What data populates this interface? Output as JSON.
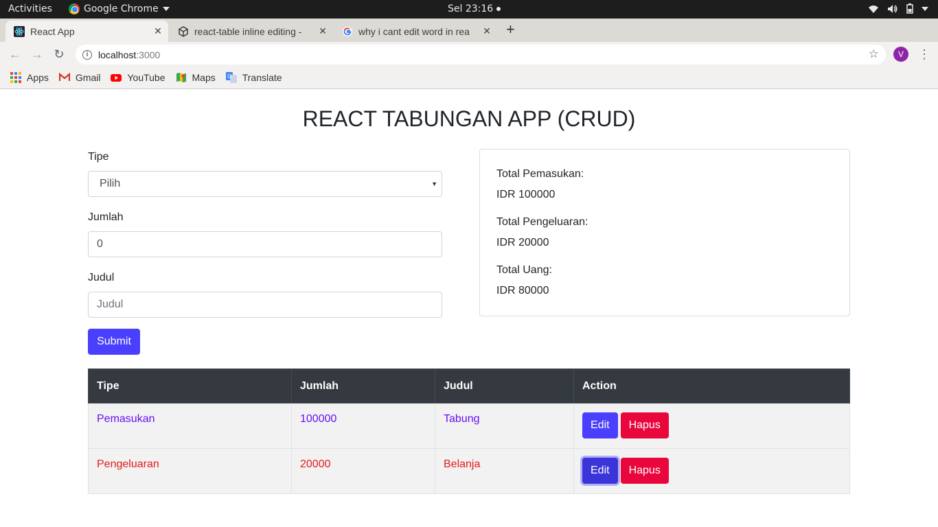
{
  "system_bar": {
    "activities": "Activities",
    "app_name": "Google Chrome",
    "clock": "Sel 23:16"
  },
  "browser": {
    "tabs": [
      {
        "title": "React App",
        "active": true
      },
      {
        "title": "react-table inline editing -",
        "active": false
      },
      {
        "title": "why i cant edit word in rea",
        "active": false
      }
    ],
    "url_host": "localhost",
    "url_port": ":3000",
    "avatar_letter": "V",
    "bookmarks": [
      "Apps",
      "Gmail",
      "YouTube",
      "Maps",
      "Translate"
    ]
  },
  "app": {
    "title": "REACT TABUNGAN APP (CRUD)",
    "form": {
      "tipe_label": "Tipe",
      "tipe_selected": "Pilih",
      "jumlah_label": "Jumlah",
      "jumlah_value": "0",
      "judul_label": "Judul",
      "judul_placeholder": "Judul",
      "submit_label": "Submit"
    },
    "summary": {
      "pemasukan_label": "Total Pemasukan:",
      "pemasukan_value": "IDR 100000",
      "pengeluaran_label": "Total Pengeluaran:",
      "pengeluaran_value": "IDR 20000",
      "uang_label": "Total Uang:",
      "uang_value": "IDR 80000"
    },
    "table": {
      "headers": [
        "Tipe",
        "Jumlah",
        "Judul",
        "Action"
      ],
      "rows": [
        {
          "tipe": "Pemasukan",
          "jumlah": "100000",
          "judul": "Tabung",
          "edit": "Edit",
          "hapus": "Hapus",
          "color": "#6610f2"
        },
        {
          "tipe": "Pengeluaran",
          "jumlah": "20000",
          "judul": "Belanja",
          "edit": "Edit",
          "hapus": "Hapus",
          "color": "#e41a1a"
        }
      ]
    }
  }
}
